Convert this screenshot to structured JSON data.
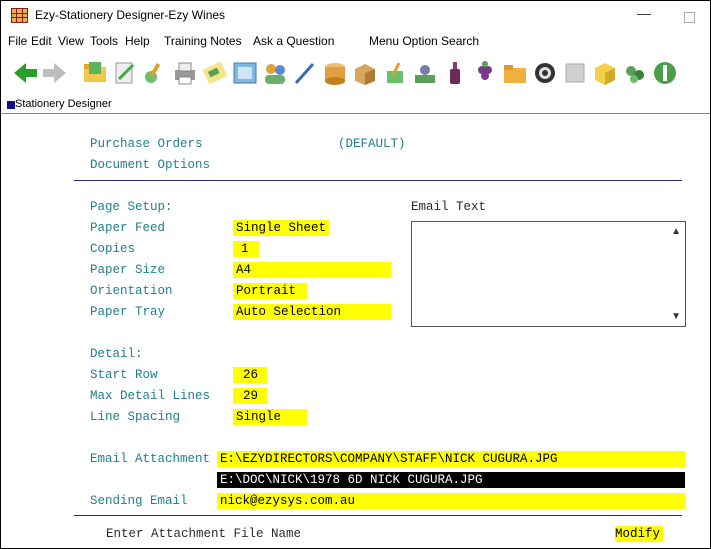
{
  "window": {
    "title": "Ezy-Stationery Designer-Ezy Wines",
    "minimize": "—"
  },
  "menu": [
    "File",
    "Edit",
    "View",
    "Tools",
    "Help",
    "Training Notes",
    "Ask a Question",
    "Menu Option Search"
  ],
  "toolbar_icons": [
    "back-arrow-icon",
    "forward-arrow-icon",
    "open-folder-icon",
    "edit-doc-icon",
    "tools-icon",
    "print-icon",
    "report-icon",
    "screen-icon",
    "contacts-icon",
    "pencil-icon",
    "cylinder-icon",
    "box-icon",
    "pen-icon",
    "money-icon",
    "bottle-icon",
    "grapes-icon",
    "folder-icon",
    "gear-icon",
    "window-icon",
    "cube-icon",
    "wine-icon",
    "dollar-icon"
  ],
  "panel": {
    "title": "Stationery Designer"
  },
  "header": {
    "document": "Purchase Orders",
    "default": "(DEFAULT)",
    "subtitle": "Document Options"
  },
  "page_setup": {
    "heading": "Page Setup:",
    "paper_feed": {
      "label": "Paper Feed",
      "value": "Single Sheet"
    },
    "copies": {
      "label": "Copies",
      "value": "1"
    },
    "paper_size": {
      "label": "Paper Size",
      "value": "A4"
    },
    "orientation": {
      "label": "Orientation",
      "value": "Portrait"
    },
    "paper_tray": {
      "label": "Paper Tray",
      "value": "Auto Selection"
    }
  },
  "email_text": {
    "label": "Email Text",
    "value": ""
  },
  "detail": {
    "heading": "Detail:",
    "start_row": {
      "label": "Start Row",
      "value": "26"
    },
    "max_lines": {
      "label": "Max Detail Lines",
      "value": "29"
    },
    "line_spacing": {
      "label": "Line Spacing",
      "value": "Single"
    }
  },
  "email_attachment": {
    "label": "Email Attachment",
    "value1": "E:\\EZYDIRECTORS\\COMPANY\\STAFF\\NICK CUGURA.JPG",
    "value2": "E:\\DOC\\NICK\\1978 6D NICK CUGURA.JPG"
  },
  "sending_email": {
    "label": "Sending Email",
    "value": "nick@ezysys.com.au"
  },
  "status": {
    "prompt": "Enter Attachment File Name",
    "mode": "Modify"
  }
}
